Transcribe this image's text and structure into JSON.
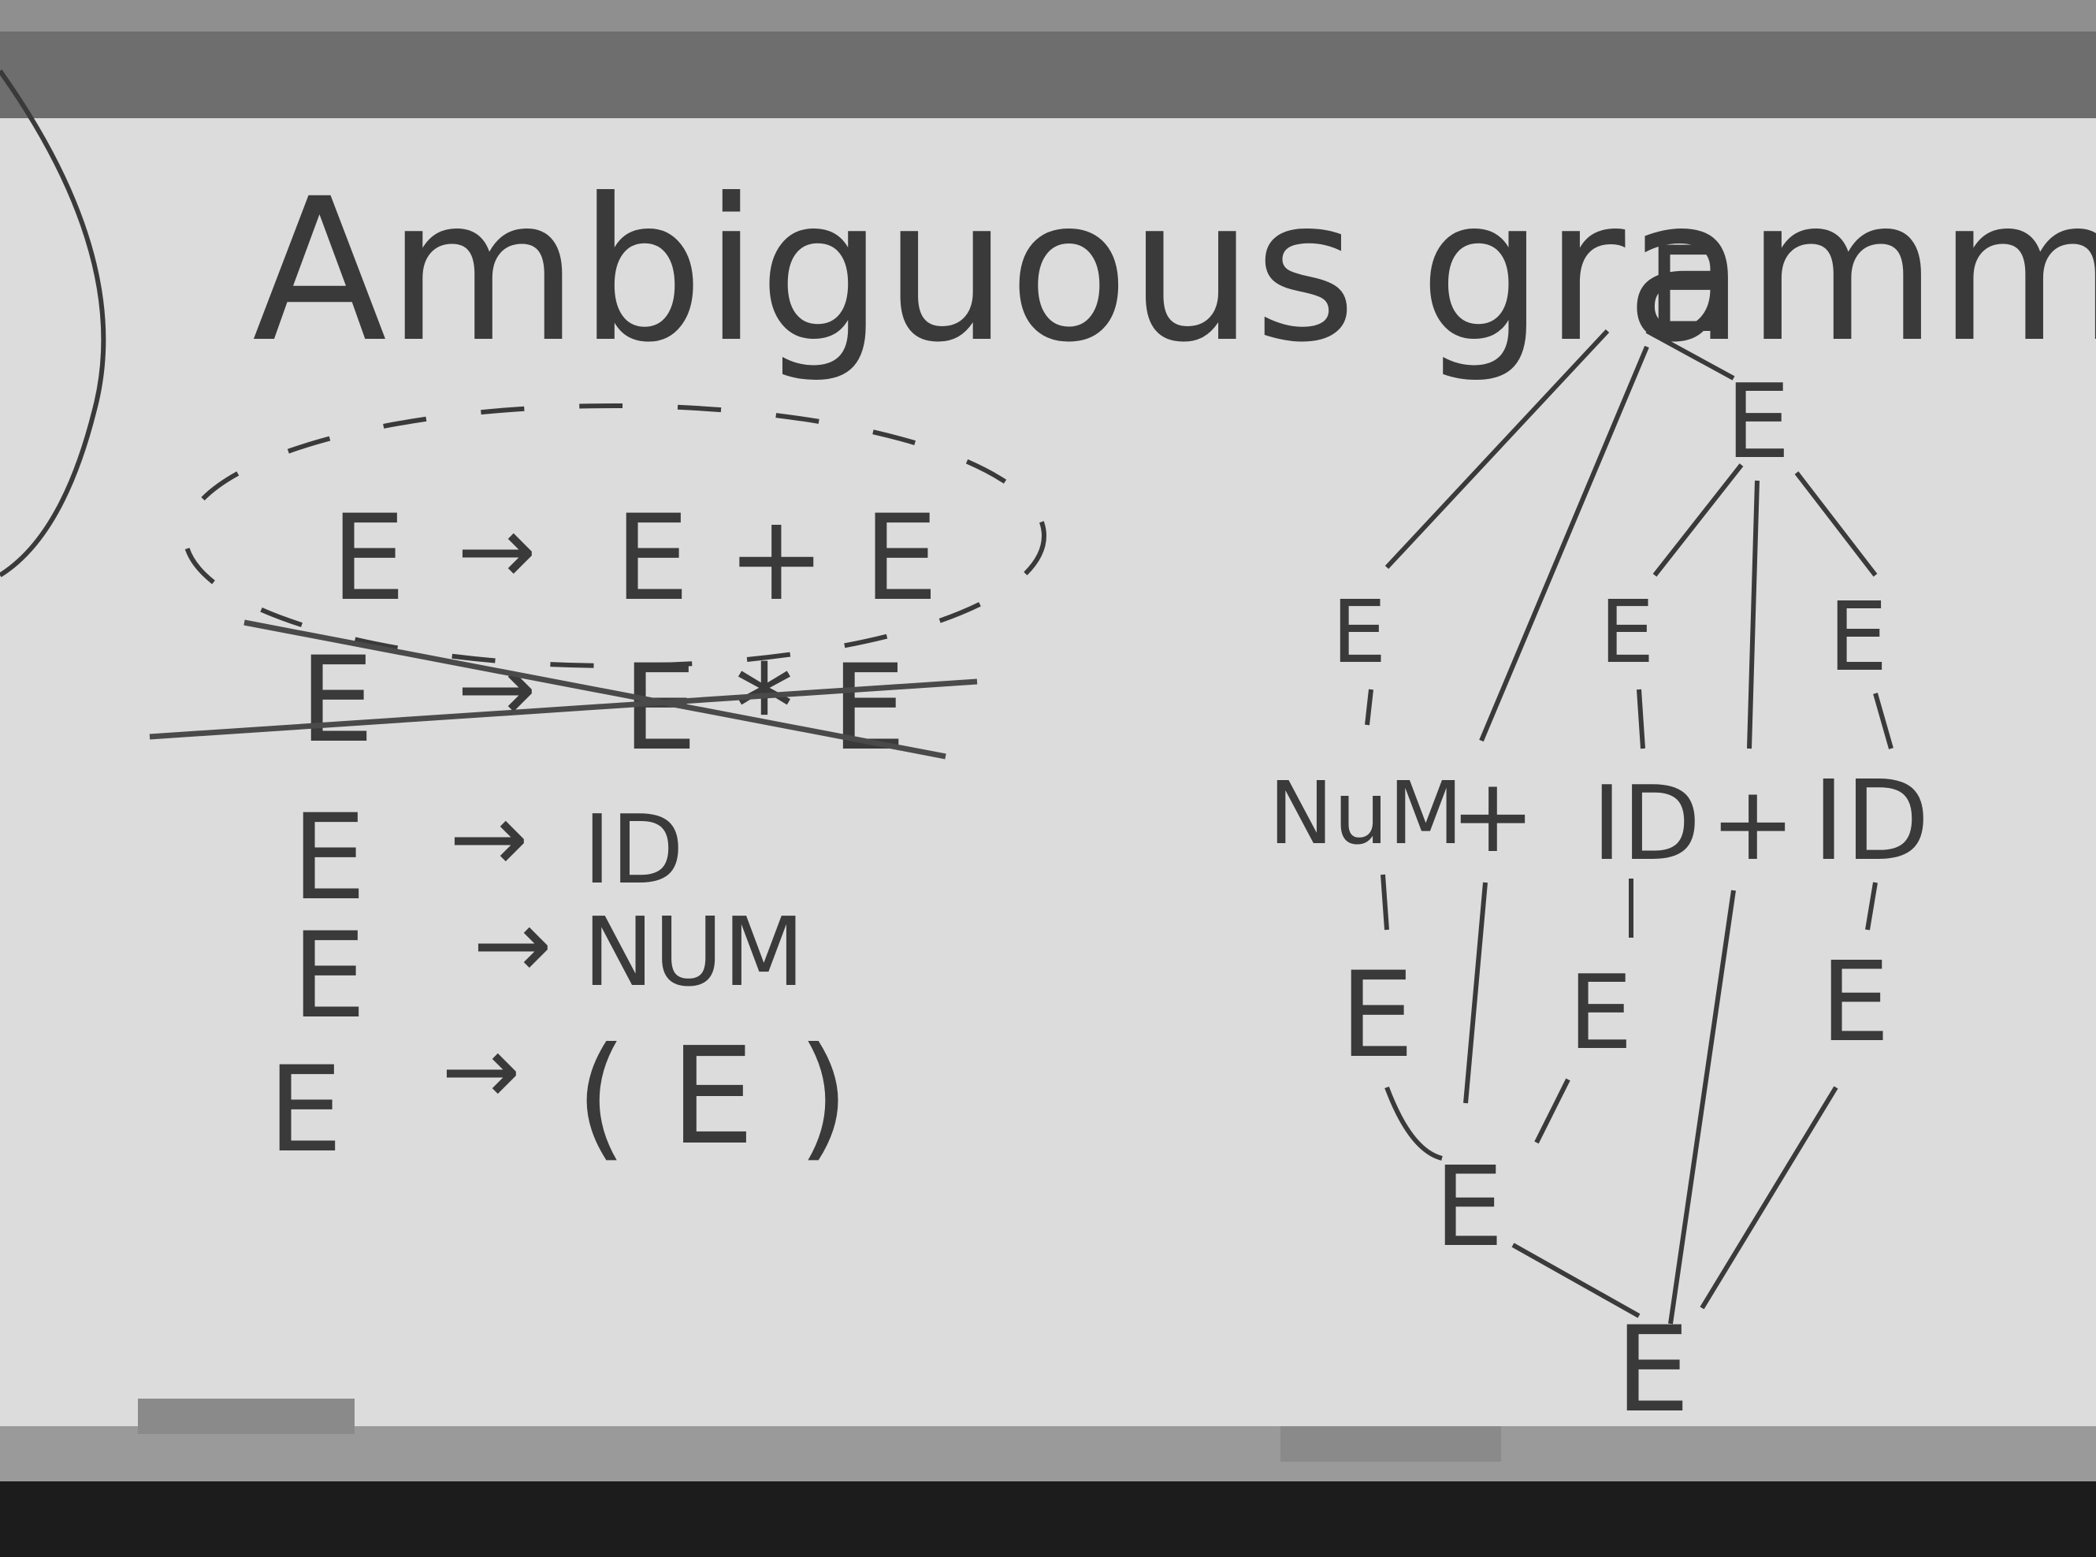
{
  "board": {
    "title": "Ambiguous grammars",
    "colors": {
      "wall": "#8f8f8f",
      "frame": "#6e6e6e",
      "board": "#dcdcdc",
      "ink": "#3a3a3a",
      "tray": "#9a9a9a",
      "floor": "#1c1c1c"
    }
  },
  "grammar": {
    "rules": [
      {
        "lhs": "E",
        "arrow": "→",
        "rhs": "E + E",
        "status": "circled"
      },
      {
        "lhs": "E",
        "arrow": "→",
        "rhs": "E * E",
        "status": "crossed-out"
      },
      {
        "lhs": "E",
        "arrow": "→",
        "rhs": "ID",
        "status": "normal"
      },
      {
        "lhs": "E",
        "arrow": "→",
        "rhs": "NUM",
        "status": "normal"
      },
      {
        "lhs": "E",
        "arrow": "→",
        "rhs": "( E )",
        "status": "normal"
      }
    ]
  },
  "parse_tree": {
    "top": {
      "root": "E",
      "child": "E",
      "left_leaf_e": "E",
      "mid_e": "E",
      "right_e": "E"
    },
    "tokens": [
      "NuM",
      "+",
      "ID",
      "+",
      "ID"
    ],
    "bottom": {
      "e1": "E",
      "e2": "E",
      "e3": "E",
      "e4": "E",
      "root": "E"
    }
  }
}
